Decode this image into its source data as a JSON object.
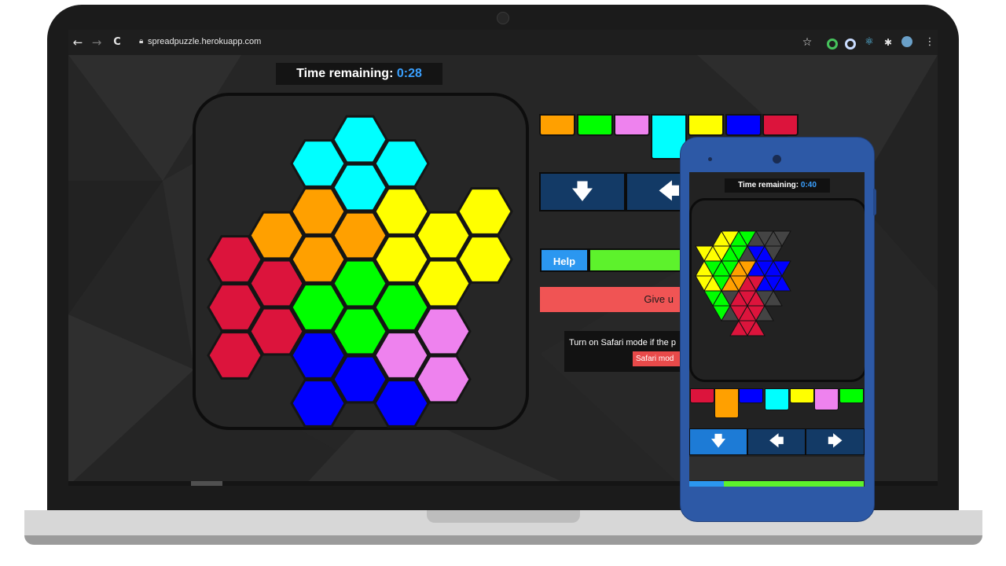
{
  "browser": {
    "back_icon": "arrow-left-icon",
    "forward_icon": "arrow-right-icon",
    "reload_icon": "reload-icon",
    "url": "spreadpuzzle.herokuapp.com",
    "back_glyph": "←",
    "forward_glyph": "→",
    "reload_glyph": "C",
    "star_glyph": "☆",
    "menu_glyph": "⋮"
  },
  "desktop": {
    "timer_label": "Time remaining:",
    "timer_value": "0:28",
    "help_label": "Help",
    "giveup_label": "Give u",
    "safari_text": "Turn on Safari mode if the p",
    "safari_button": "Safari mod",
    "arrow_down": "🡇",
    "arrow_left": "🡄"
  },
  "mobile": {
    "timer_label": "Time remaining:",
    "timer_value": "0:40",
    "arrow_down": "🡇",
    "arrow_left": "🡄",
    "arrow_right": "🡆"
  },
  "colors": {
    "orange": "#ffa000",
    "green": "#00ff00",
    "violet": "#ee82ee",
    "cyan": "#00ffff",
    "yellow": "#ffff00",
    "blue": "#0000ff",
    "crimson": "#dc143c",
    "grey": "#444444"
  },
  "desktop_tray": [
    "orange",
    "green",
    "violet",
    "cyan",
    "yellow",
    "blue",
    "crimson"
  ],
  "mobile_tray": [
    "crimson",
    "orange",
    "blue",
    "cyan",
    "yellow",
    "violet",
    "green"
  ]
}
